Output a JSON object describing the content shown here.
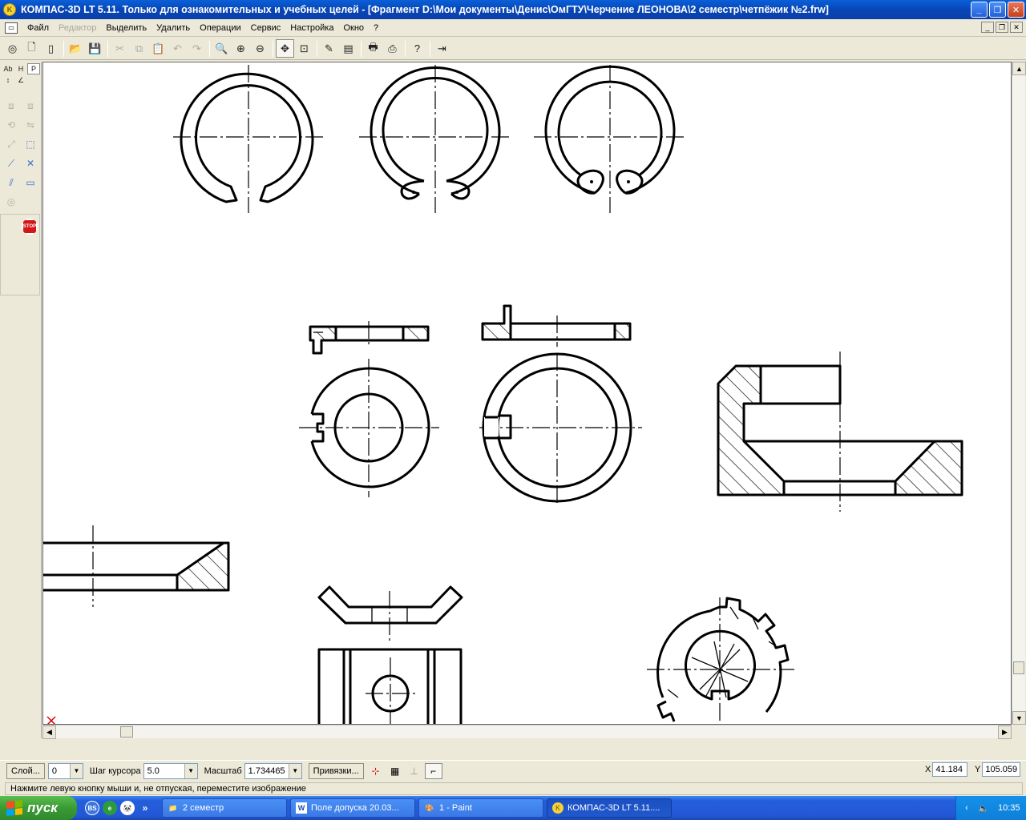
{
  "window": {
    "title": "КОМПАС-3D LT 5.11. Только для ознакомительных и учебных целей - [Фрагмент D:\\Мои документы\\Денис\\ОмГТУ\\Черчение ЛЕОНОВА\\2 семестр\\четпёжик №2.frw]",
    "minimize": "_",
    "maximize": "❐",
    "close": "✕"
  },
  "menu": {
    "items": [
      {
        "label": "Файл",
        "enabled": true
      },
      {
        "label": "Редактор",
        "enabled": false
      },
      {
        "label": "Выделить",
        "enabled": true
      },
      {
        "label": "Удалить",
        "enabled": true
      },
      {
        "label": "Операции",
        "enabled": true
      },
      {
        "label": "Сервис",
        "enabled": true
      },
      {
        "label": "Настройка",
        "enabled": true
      },
      {
        "label": "Окно",
        "enabled": true
      },
      {
        "label": "?",
        "enabled": true
      }
    ]
  },
  "toolbar": {
    "icons": [
      "compass-icon",
      "new-document-icon",
      "new-sheet-icon",
      "open-folder-icon",
      "save-icon",
      "cut-icon",
      "copy-icon",
      "paste-icon",
      "undo-icon",
      "redo-icon",
      "zoom-icon",
      "zoom-in-icon",
      "zoom-out-icon",
      "pan-icon",
      "zoom-fit-icon",
      "properties-icon",
      "layer-icon",
      "print-preview-icon",
      "print-icon",
      "help-icon",
      "exit-icon"
    ]
  },
  "leftpanel": {
    "tabs": [
      "Ab",
      "H",
      "P",
      "↕",
      "∠"
    ],
    "stop_label": "STOP"
  },
  "propbar": {
    "layer_button": "Слой...",
    "layer_value": "0",
    "step_label": "Шаг курсора",
    "step_value": "5.0",
    "scale_label": "Масштаб",
    "scale_value": "1.734465",
    "snap_button": "Привязки...",
    "x_label": "X",
    "x_value": "41.184",
    "y_label": "Y",
    "y_value": "105.059"
  },
  "hint": {
    "text": "Нажмите левую кнопку мыши и, не отпуская, переместите изображение"
  },
  "taskbar": {
    "start_label": "пуск",
    "buttons": [
      {
        "label": "2 семестр",
        "icon": "folder-icon"
      },
      {
        "label": "Поле допуска 20.03...",
        "icon": "word-icon"
      },
      {
        "label": "1 - Paint",
        "icon": "paint-icon"
      },
      {
        "label": "КОМПАС-3D LT 5.11....",
        "icon": "kompas-icon"
      }
    ],
    "clock": "10:35"
  }
}
